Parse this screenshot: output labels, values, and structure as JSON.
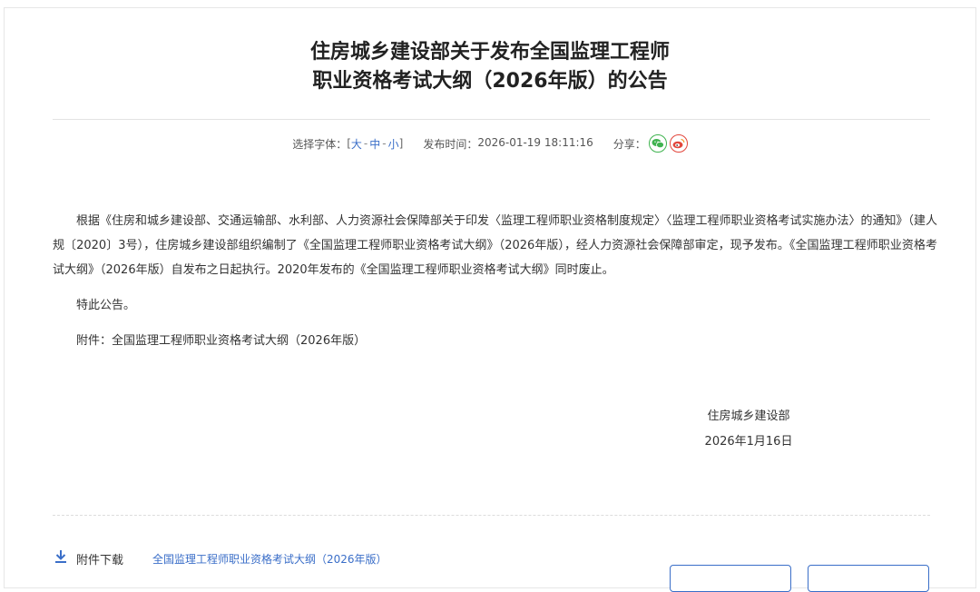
{
  "announcement": {
    "title_line1": "住房城乡建设部关于发布全国监理工程师",
    "title_line2": "职业资格考试大纲（2026年版）的公告"
  },
  "meta": {
    "font_select_label": "选择字体：",
    "bracket_open": "[",
    "bracket_close": "]",
    "font_large": "大",
    "font_medium": "中",
    "font_small": "小",
    "separator": "-",
    "publish_time_label": "发布时间：",
    "publish_time": "2026-01-19 18:11:16",
    "share_label": "分享：",
    "share_icons": [
      "wechat-icon",
      "weibo-icon"
    ]
  },
  "body": {
    "paragraph1": "根据《住房和城乡建设部、交通运输部、水利部、人力资源社会保障部关于印发〈监理工程师职业资格制度规定〉〈监理工程师职业资格考试实施办法〉的通知》（建人规〔2020〕3号），住房城乡建设部组织编制了《全国监理工程师职业资格考试大纲》（2026年版），经人力资源社会保障部审定，现予发布。《全国监理工程师职业资格考试大纲》（2026年版）自发布之日起执行。2020年发布的《全国监理工程师职业资格考试大纲》同时废止。",
    "paragraph2": "特此公告。",
    "paragraph3": "附件：全国监理工程师职业资格考试大纲（2026年版）"
  },
  "signature": {
    "org": "住房城乡建设部",
    "date": "2026年1月16日"
  },
  "attachment": {
    "label": "附件下载",
    "file_name": "全国监理工程师职业资格考试大纲（2026年版）"
  },
  "colors": {
    "link": "#3a6ec8",
    "wechat": "#3fb34f",
    "weibo": "#e2463c"
  }
}
